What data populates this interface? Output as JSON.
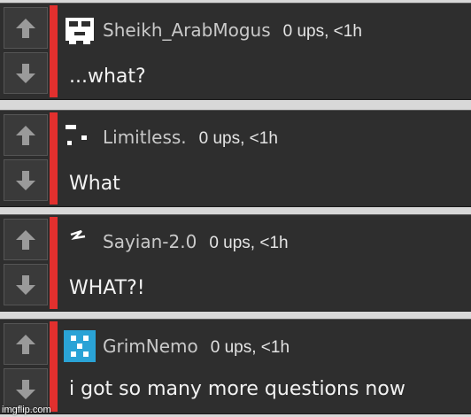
{
  "colors": {
    "panel": "#2e2e2e",
    "accent_bar": "#e2302e",
    "username": "#c9c9c9",
    "text": "#f2f2f2",
    "avatar_blue": "#2aa3d6"
  },
  "icons": {
    "upvote": "arrow-up-icon",
    "downvote": "arrow-down-icon"
  },
  "comments": [
    {
      "username": "Sheikh_ArabMogus",
      "score": "0 ups, <1h",
      "text": "...what?"
    },
    {
      "username": "Limitless.",
      "score": "0 ups, <1h",
      "text": "What"
    },
    {
      "username": "Sayian-2.0",
      "score": "0 ups, <1h",
      "text": "WHAT?!"
    },
    {
      "username": "GrimNemo",
      "score": "0 ups, <1h",
      "text": "i got so many more questions now"
    }
  ],
  "watermark": "imgflip.com"
}
